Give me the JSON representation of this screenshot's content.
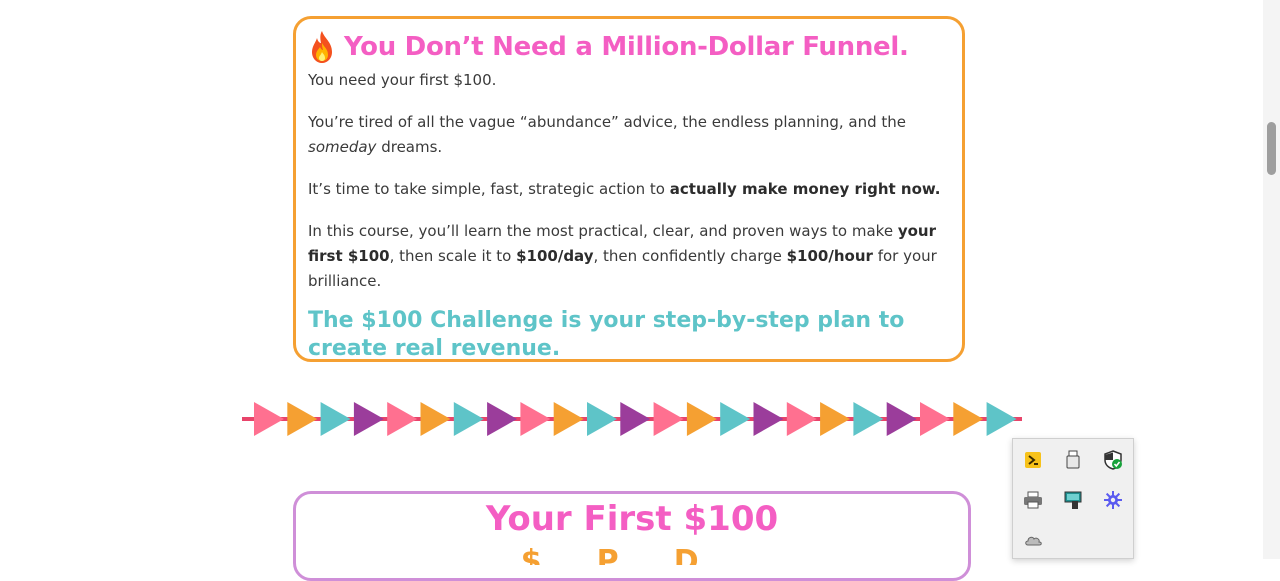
{
  "intro": {
    "headline": "You Don’t Need a Million-Dollar Funnel.",
    "fire_icon": "fire-icon",
    "p1": "You need your first $100.",
    "p2_before": "You’re tired of all the vague “abundance” advice, the endless planning, and the ",
    "p2_italic": "someday",
    "p2_after": " dreams.",
    "p3_before": "It’s time to take simple, fast, strategic action to ",
    "p3_bold": "actually make money right now.",
    "p4_a": "In this course, you’ll learn the most practical, clear, and proven ways to make ",
    "p4_b": "your first $100",
    "p4_c": ", then scale it to ",
    "p4_d": "$100/day",
    "p4_e": ", then confidently charge ",
    "p4_f": "$100/hour",
    "p4_g": " for your brilliance.",
    "challenge": "The $100 Challenge is your step-by-step plan to create real revenue."
  },
  "next_section": {
    "title": "Your First $100",
    "subtitle": "$ ... P ... D ..."
  },
  "divider": {
    "colors": [
      "#ff7090",
      "#f5a032",
      "#5ec4c8",
      "#9b3d9b"
    ],
    "line_color": "#e8446a"
  },
  "tray_icons": [
    "terminal-icon",
    "usb-drive-icon",
    "security-shield-icon",
    "printer-icon",
    "network-card-icon",
    "bluetooth-gear-icon",
    "cloud-icon"
  ],
  "colors": {
    "pink": "#f45ec3",
    "orange": "#f5a032",
    "teal": "#5ec4c8",
    "purple": "#cf8fd8"
  }
}
